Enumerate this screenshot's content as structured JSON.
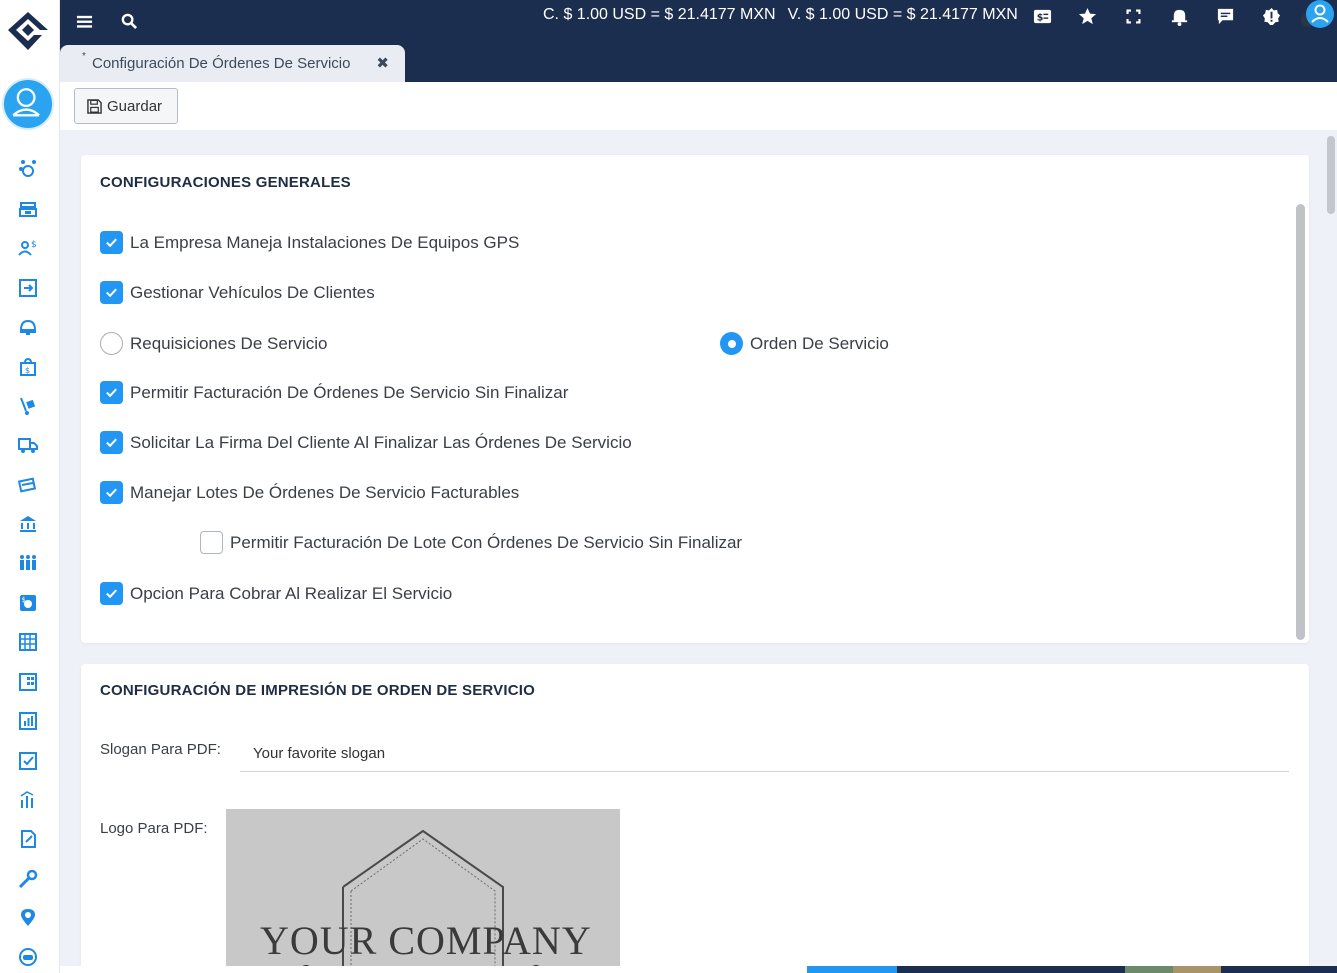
{
  "topbar": {
    "rate_purchase": "C. $ 1.00 USD = $ 21.4177 MXN",
    "rate_sale": "V. $ 1.00 USD = $ 21.4177 MXN"
  },
  "tab": {
    "modified_marker": "*",
    "title": "Configuración De Órdenes De Servicio",
    "close_glyph": "✖"
  },
  "toolbar": {
    "save_label": "Guardar"
  },
  "general": {
    "title": "CONFIGURACIONES GENERALES",
    "gps": {
      "label": "La Empresa Maneja Instalaciones De Equipos GPS",
      "checked": true
    },
    "vehicles": {
      "label": "Gestionar Vehículos De Clientes",
      "checked": true
    },
    "radio_requisiciones": {
      "label": "Requisiciones De Servicio",
      "selected": false
    },
    "radio_orden": {
      "label": "Orden De Servicio",
      "selected": true
    },
    "billing_unfinished": {
      "label": "Permitir Facturación De Órdenes De Servicio Sin Finalizar",
      "checked": true
    },
    "signature": {
      "label": "Solicitar La Firma Del Cliente Al Finalizar Las Órdenes De Servicio",
      "checked": true
    },
    "lots": {
      "label": "Manejar Lotes De Órdenes De Servicio Facturables",
      "checked": true
    },
    "lot_unfinished": {
      "label": "Permitir Facturación De Lote Con Órdenes De Servicio Sin Finalizar",
      "checked": false
    },
    "charge": {
      "label": "Opcion Para Cobrar Al Realizar El Servicio",
      "checked": true
    }
  },
  "print": {
    "title": "CONFIGURACIÓN DE IMPRESIÓN DE ORDEN DE SERVICIO",
    "slogan_label": "Slogan Para PDF:",
    "slogan_value": "Your favorite slogan",
    "logo_label": "Logo Para PDF:",
    "logo_text": "YOUR COMPANY"
  },
  "colors": {
    "topbar": "#1c2e4f",
    "accent": "#2196f3",
    "sidebar_icon": "#1e88e5"
  }
}
